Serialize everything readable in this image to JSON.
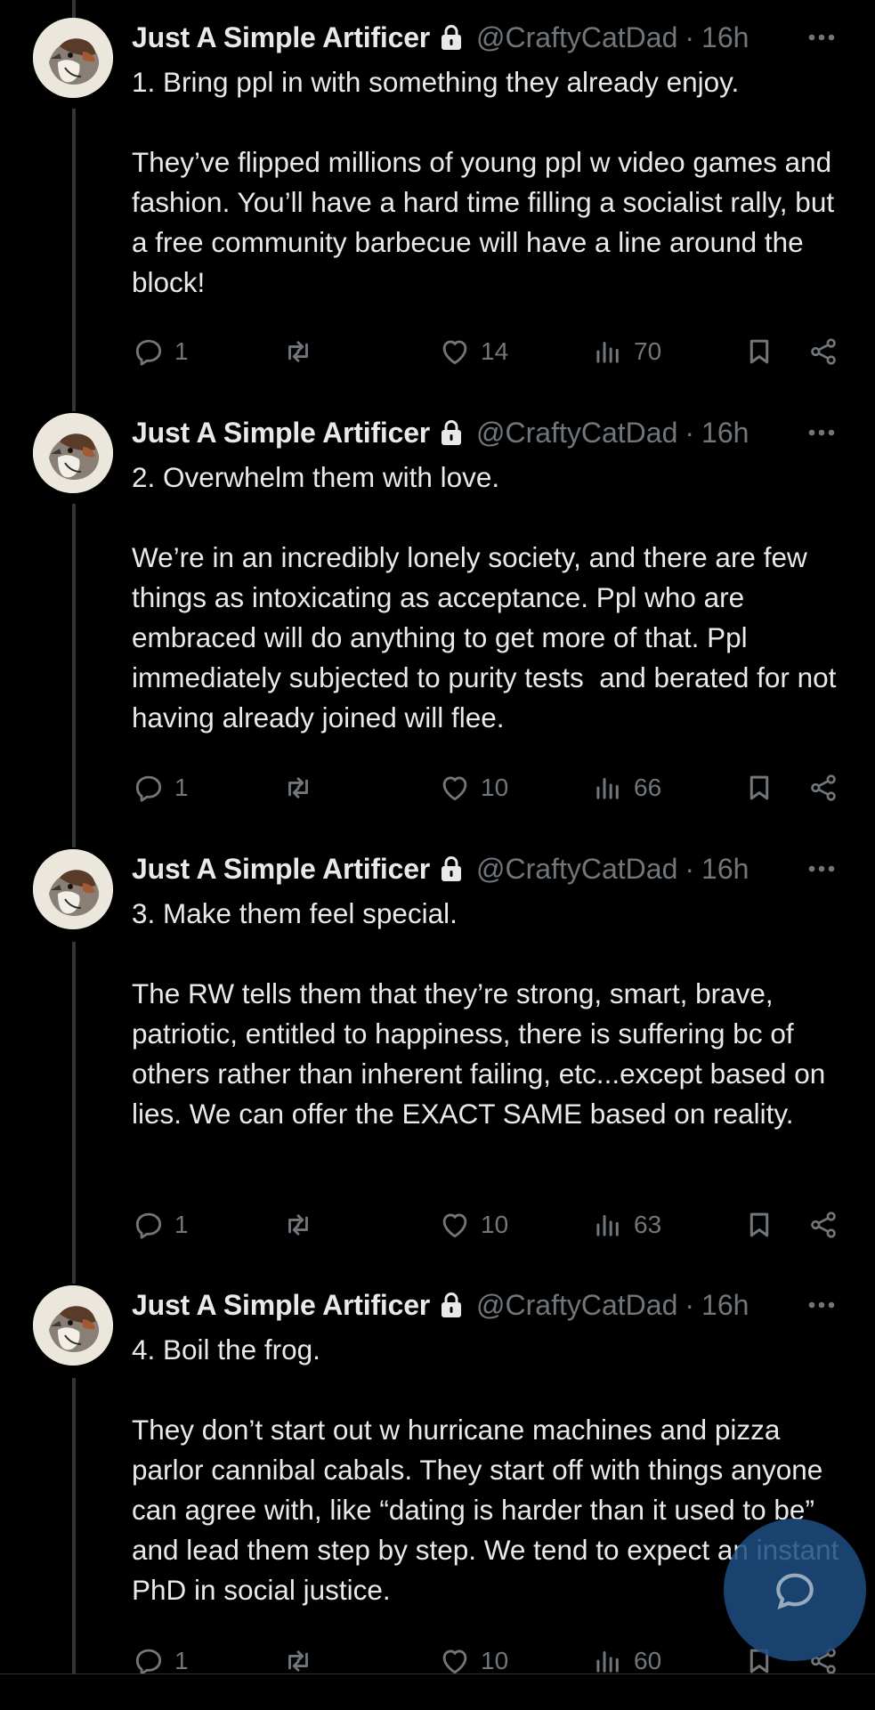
{
  "author": {
    "name": "Just A Simple Artificer",
    "handle": "@CraftyCatDad",
    "separator": "·",
    "time": "16h"
  },
  "tweets": [
    {
      "text": "1. Bring ppl in with something they already enjoy.\n\nThey’ve flipped millions of young ppl w video games and fashion. You’ll have a hard time filling a socialist rally, but a free community barbecue will have a line around the block!",
      "replies": "1",
      "retweets": "",
      "likes": "14",
      "views": "70"
    },
    {
      "text": "2. Overwhelm them with love.\n\nWe’re in an incredibly lonely society, and there are few things as intoxicating as acceptance. Ppl who are embraced will do anything to get more of that. Ppl immediately subjected to purity tests  and berated for not having already joined will flee.",
      "replies": "1",
      "retweets": "",
      "likes": "10",
      "views": "66"
    },
    {
      "text": "3. Make them feel special.\n\nThe RW tells them that they’re strong, smart, brave, patriotic, entitled to happiness, there is suffering bc of others rather than inherent failing, etc...except based on lies. We can offer the EXACT SAME based on reality.",
      "replies": "1",
      "retweets": "",
      "likes": "10",
      "views": "63"
    },
    {
      "text": "4. Boil the frog.\n\nThey don’t start out w hurricane machines and pizza parlor cannibal cabals. They start off with things anyone can agree with, like “dating is harder than it used to be” and lead them step by step. We tend to expect an instant PhD in social justice.",
      "replies": "1",
      "retweets": "",
      "likes": "10",
      "views": "60"
    }
  ],
  "icons": {
    "reply": "reply-icon",
    "retweet": "retweet-icon",
    "like": "heart-icon",
    "views": "views-icon",
    "bookmark": "bookmark-icon",
    "share": "share-icon",
    "more": "more-icon",
    "lock": "lock-icon",
    "compose": "compose-reply-icon"
  },
  "colors": {
    "background": "#000000",
    "text": "#e7e9ea",
    "muted": "#71767b",
    "fab": "#1d4e82"
  }
}
